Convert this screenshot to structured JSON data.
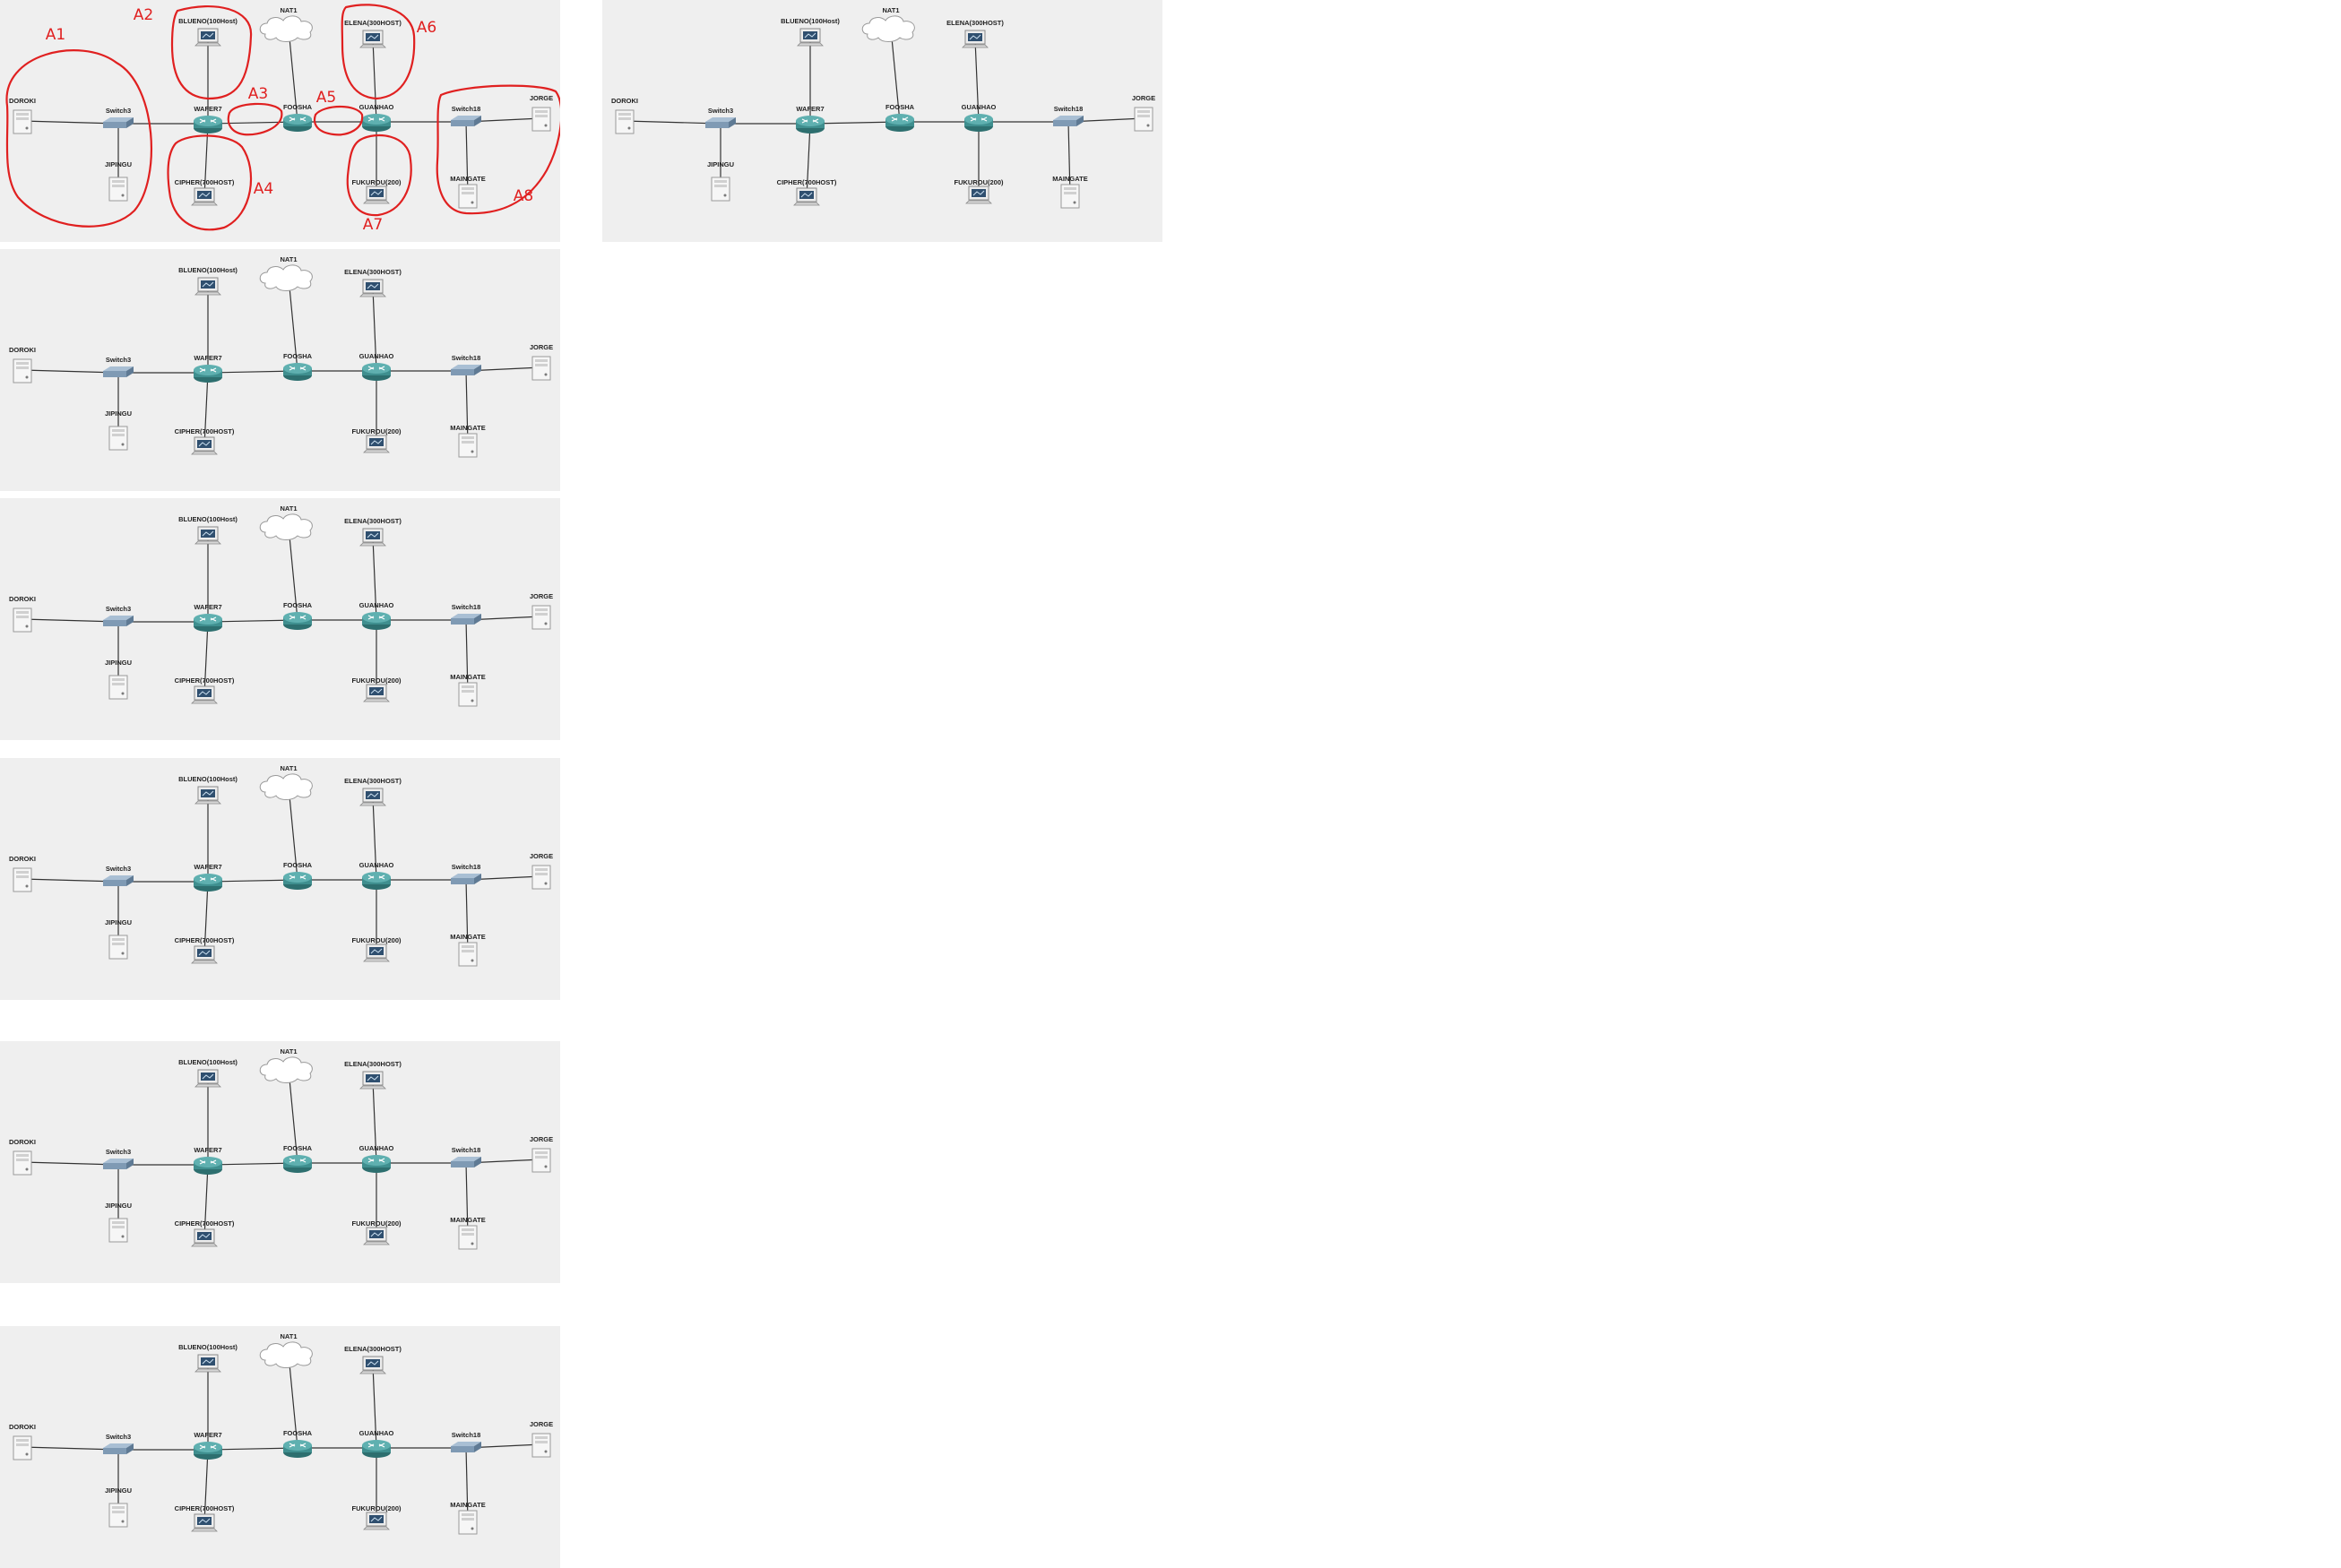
{
  "diagram": {
    "nodes": [
      {
        "id": "doroki",
        "label": "DOROKI",
        "type": "server"
      },
      {
        "id": "switch3",
        "label": "Switch3",
        "type": "switch"
      },
      {
        "id": "jiping",
        "label": "JIPINGU",
        "type": "server"
      },
      {
        "id": "wafer",
        "label": "WAFER7",
        "type": "router"
      },
      {
        "id": "blueno",
        "label": "BLUENO(100Host)",
        "type": "pc"
      },
      {
        "id": "cipher",
        "label": "CIPHER(700HOST)",
        "type": "pc"
      },
      {
        "id": "nat",
        "label": "NAT1",
        "type": "cloud"
      },
      {
        "id": "foosha",
        "label": "FOOSHA",
        "type": "router"
      },
      {
        "id": "guanhao",
        "label": "GUANHAO",
        "type": "router"
      },
      {
        "id": "elena",
        "label": "ELENA(300HOST)",
        "type": "pc"
      },
      {
        "id": "fukurou",
        "label": "FUKUROU(200)",
        "type": "pc"
      },
      {
        "id": "switch18",
        "label": "Switch18",
        "type": "switch"
      },
      {
        "id": "jorge",
        "label": "JORGE",
        "type": "server"
      },
      {
        "id": "maingate",
        "label": "MAINGATE",
        "type": "server"
      }
    ],
    "links": [
      [
        "doroki",
        "switch3"
      ],
      [
        "switch3",
        "jiping"
      ],
      [
        "switch3",
        "wafer"
      ],
      [
        "wafer",
        "blueno"
      ],
      [
        "wafer",
        "cipher"
      ],
      [
        "wafer",
        "foosha"
      ],
      [
        "foosha",
        "nat"
      ],
      [
        "foosha",
        "guanhao"
      ],
      [
        "guanhao",
        "elena"
      ],
      [
        "guanhao",
        "fukurou"
      ],
      [
        "guanhao",
        "switch18"
      ],
      [
        "switch18",
        "jorge"
      ],
      [
        "switch18",
        "maingate"
      ]
    ]
  },
  "annotations": {
    "color": "#e02020",
    "labels": [
      "A1",
      "A2",
      "A3",
      "A4",
      "A5",
      "A6",
      "A7",
      "A8"
    ]
  },
  "colors": {
    "background": "#efefef",
    "router": "#3f8f8f",
    "switch": "#7f9ab4",
    "line": "#333333",
    "annotation": "#e02020"
  }
}
